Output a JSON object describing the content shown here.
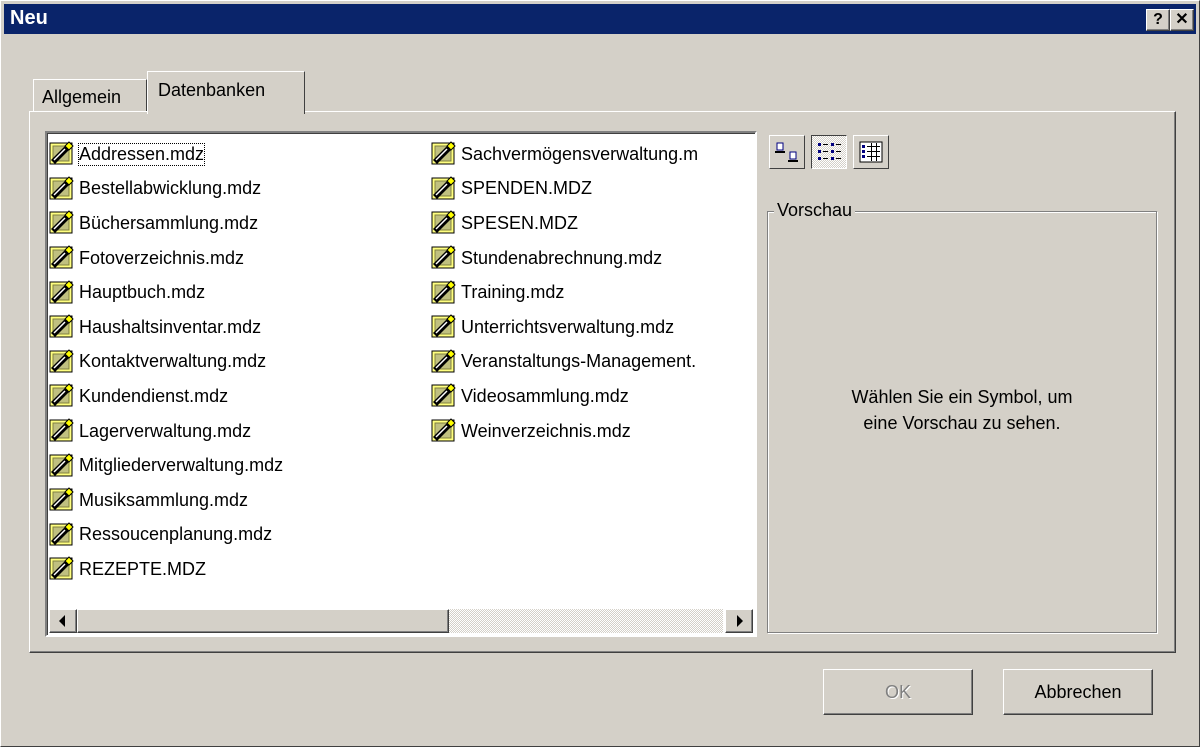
{
  "window": {
    "title": "Neu",
    "help_label": "?",
    "close_label": "✕"
  },
  "tabs": [
    {
      "label": "Allgemein",
      "active": false
    },
    {
      "label": "Datenbanken",
      "active": true
    }
  ],
  "files": {
    "column1": [
      "Addressen.mdz",
      "Bestellabwicklung.mdz",
      "Büchersammlung.mdz",
      "Fotoverzeichnis.mdz",
      "Hauptbuch.mdz",
      "Haushaltsinventar.mdz",
      "Kontaktverwaltung.mdz",
      "Kundendienst.mdz",
      "Lagerverwaltung.mdz",
      "Mitgliederverwaltung.mdz",
      "Musiksammlung.mdz",
      "Ressoucenplanung.mdz",
      "REZEPTE.MDZ"
    ],
    "column2": [
      "Sachvermögensverwaltung.m",
      "SPENDEN.MDZ",
      "SPESEN.MDZ",
      "Stundenabrechnung.mdz",
      "Training.mdz",
      "Unterrichtsverwaltung.mdz",
      "Veranstaltungs-Management.",
      "Videosammlung.mdz",
      "Weinverzeichnis.mdz"
    ],
    "focused_item": "Addressen.mdz",
    "item_icon": "database-wizard-icon"
  },
  "view_buttons": [
    {
      "name": "large-icons-view-icon",
      "pressed": false
    },
    {
      "name": "list-view-icon",
      "pressed": true
    },
    {
      "name": "details-view-icon",
      "pressed": false
    }
  ],
  "preview": {
    "legend": "Vorschau",
    "message_line1": "Wählen Sie ein Symbol, um",
    "message_line2": "eine Vorschau zu sehen."
  },
  "buttons": {
    "ok": "OK",
    "cancel": "Abbrechen",
    "ok_enabled": false
  },
  "colors": {
    "titlebar": "#0a246a",
    "face": "#d4d0c8"
  }
}
